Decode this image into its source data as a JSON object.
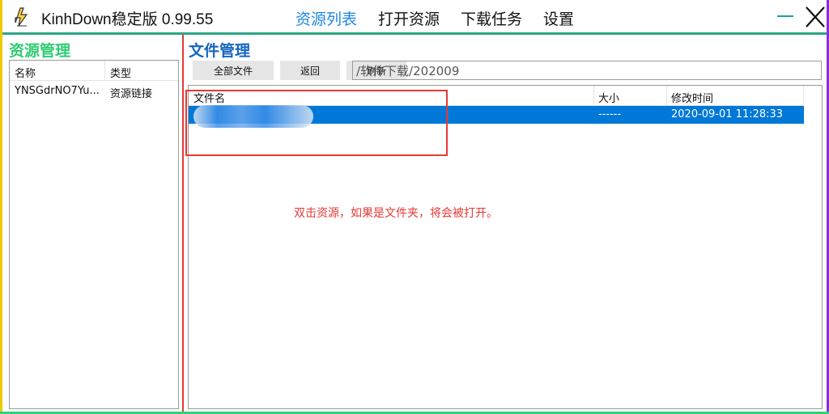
{
  "window": {
    "title": "KinhDown稳定版 0.99.55",
    "nav": [
      "资源列表",
      "打开资源",
      "下载任务",
      "设置"
    ],
    "active_nav": "资源列表"
  },
  "left": {
    "title": "资源管理",
    "columns": [
      "名称",
      "类型"
    ],
    "rows": [
      {
        "name": "YNSGdrNO7Yu...",
        "type": "资源链接"
      }
    ]
  },
  "right": {
    "title": "文件管理",
    "buttons": {
      "all_files": "全部文件",
      "back": "返回",
      "refresh": "刷新"
    },
    "path": "/软件下载/202009",
    "columns": {
      "name": "文件名",
      "size": "大小",
      "modified": "修改时间"
    },
    "rows": [
      {
        "size": "------",
        "modified": "2020-09-01 11:28:33"
      }
    ],
    "hint": "双击资源，如果是文件夹，将会被打开。"
  },
  "colors": {
    "left_title": "#2ecc71",
    "right_title": "#1565c0",
    "selected_row": "#0078d7",
    "annotation": "#e53935",
    "active_nav": "#1e88e5"
  },
  "icons": [
    "app-lightning-icon",
    "minimize-icon",
    "close-icon"
  ]
}
